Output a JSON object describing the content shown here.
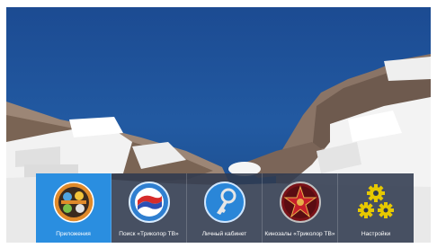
{
  "background": {
    "sea_color": "#1f5399",
    "cliff_color": "#b39a8a",
    "building_color": "#f4f4f4"
  },
  "menu": {
    "active_color": "#2a8ee0",
    "tile_color": "#303a4e",
    "items": [
      {
        "label": "Приложения",
        "icon": "apps-icon",
        "active": true
      },
      {
        "label": "Поиск «Триколор ТВ»",
        "icon": "tricolor-search-icon",
        "active": false
      },
      {
        "label": "Личный кабинет",
        "icon": "key-icon",
        "active": false
      },
      {
        "label": "Кинозалы «Триколор ТВ»",
        "icon": "cinema-star-icon",
        "active": false
      },
      {
        "label": "Настройки",
        "icon": "gears-icon",
        "active": false
      }
    ]
  }
}
